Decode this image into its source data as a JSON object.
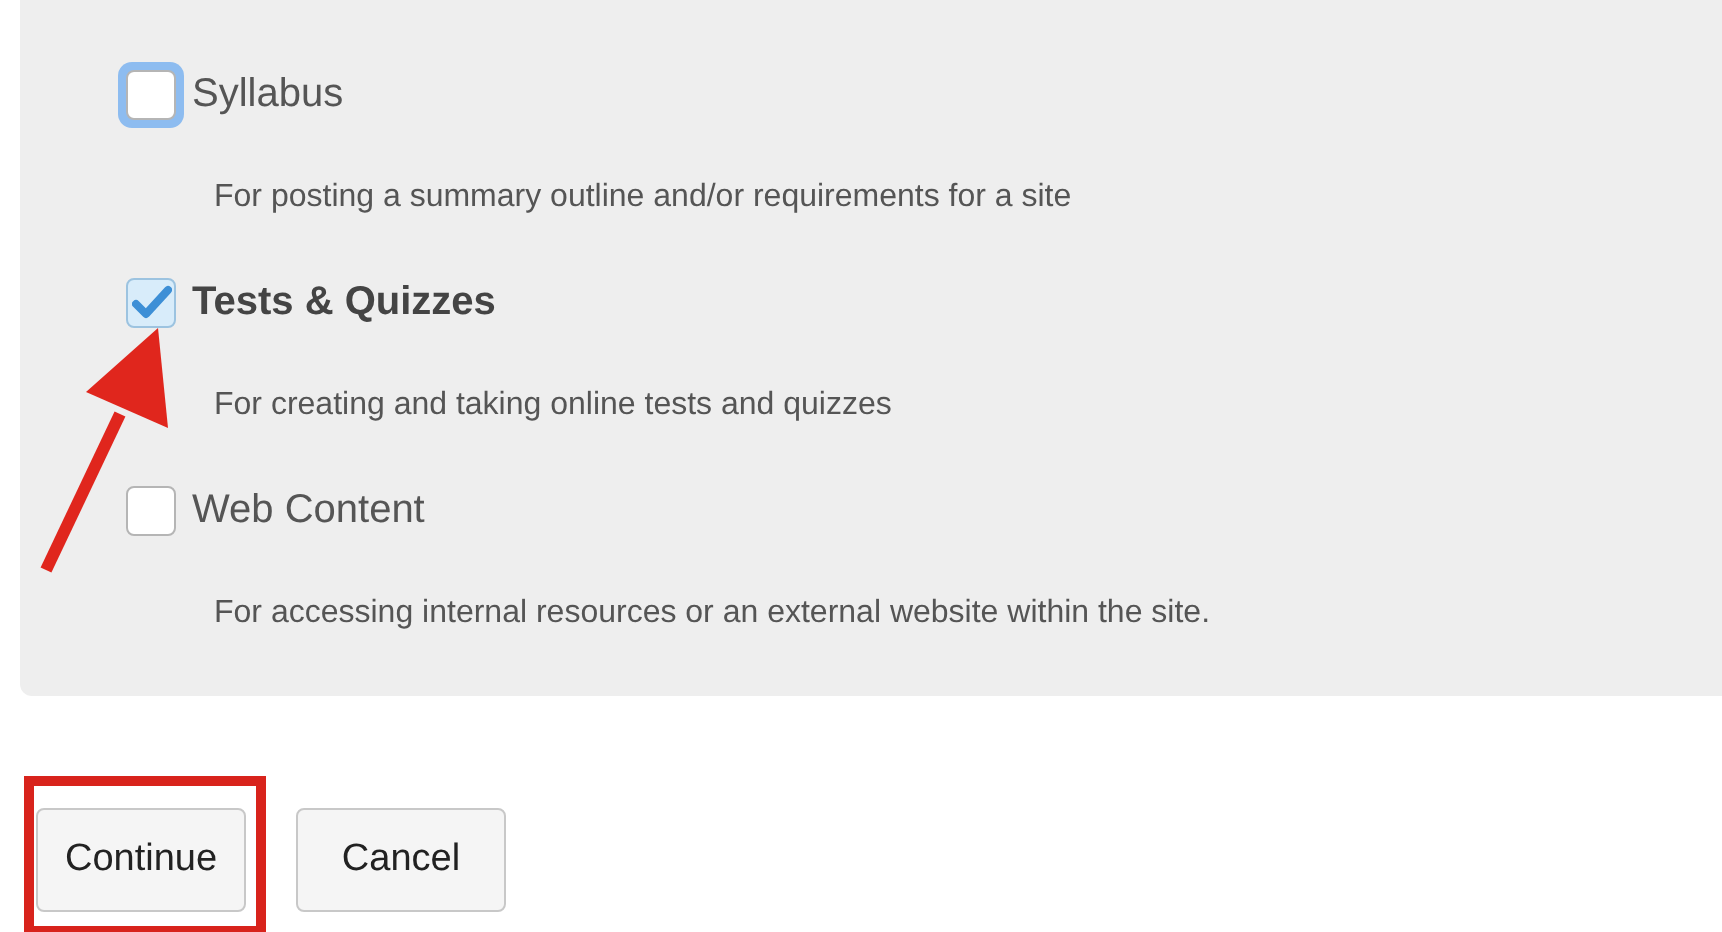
{
  "tools": [
    {
      "label": "Syllabus",
      "description": "For posting a summary outline and/or requirements for a site",
      "checked": false,
      "focused": true
    },
    {
      "label": "Tests & Quizzes",
      "description": "For creating and taking online tests and quizzes",
      "checked": true,
      "focused": false
    },
    {
      "label": "Web Content",
      "description": "For accessing internal resources or an external website within the site.",
      "checked": false,
      "focused": false
    }
  ],
  "annotation_arrow": true,
  "buttons": [
    {
      "label": "Continue",
      "highlighted": true
    },
    {
      "label": "Cancel",
      "highlighted": false
    }
  ]
}
